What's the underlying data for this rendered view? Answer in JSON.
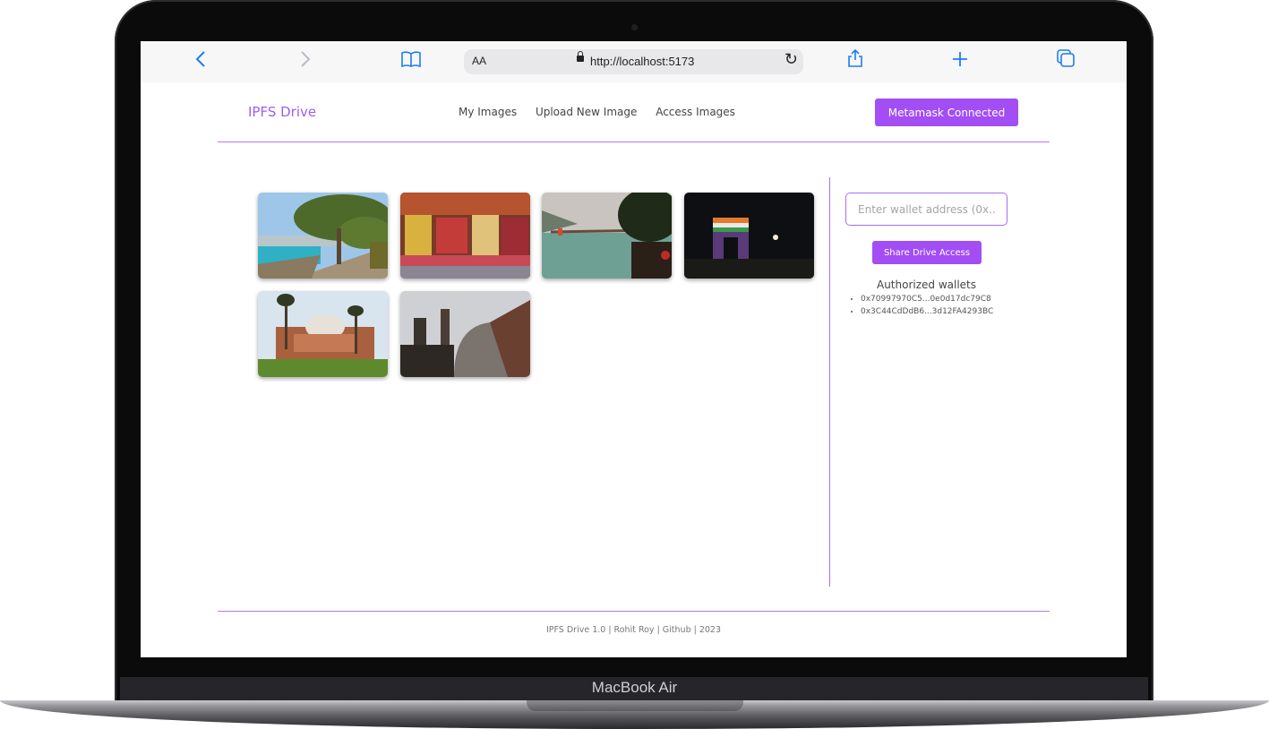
{
  "device": {
    "brand_label": "MacBook Air"
  },
  "browser": {
    "back_icon": "chevron-left-icon",
    "forward_icon": "chevron-right-icon",
    "bookmarks_icon": "book-icon",
    "text_size_label": "AA",
    "url": "http://localhost:5173",
    "reload_icon": "reload-icon",
    "share_icon": "share-icon",
    "new_tab_icon": "plus-icon",
    "tabs_icon": "tabs-icon"
  },
  "app": {
    "logo": "IPFS Drive",
    "nav": [
      "My Images",
      "Upload New Image",
      "Access Images"
    ],
    "connect_button": "Metamask Connected",
    "accent_color": "#a24ef4",
    "images": [
      {
        "name": "lakeside-tree-photo"
      },
      {
        "name": "market-stall-photo"
      },
      {
        "name": "river-bridge-photo"
      },
      {
        "name": "india-gate-night-photo"
      },
      {
        "name": "humayun-tomb-photo"
      },
      {
        "name": "mosque-dome-photo"
      }
    ],
    "share_panel": {
      "input_placeholder": "Enter wallet address (0x...)",
      "share_button": "Share Drive Access",
      "authorized_title": "Authorized wallets",
      "wallets": [
        "0x70997970C5...0e0d17dc79C8",
        "0x3C44CdDdB6...3d12FA4293BC"
      ]
    },
    "footer": "IPFS Drive 1.0 | Rohit Roy | Github | 2023"
  }
}
